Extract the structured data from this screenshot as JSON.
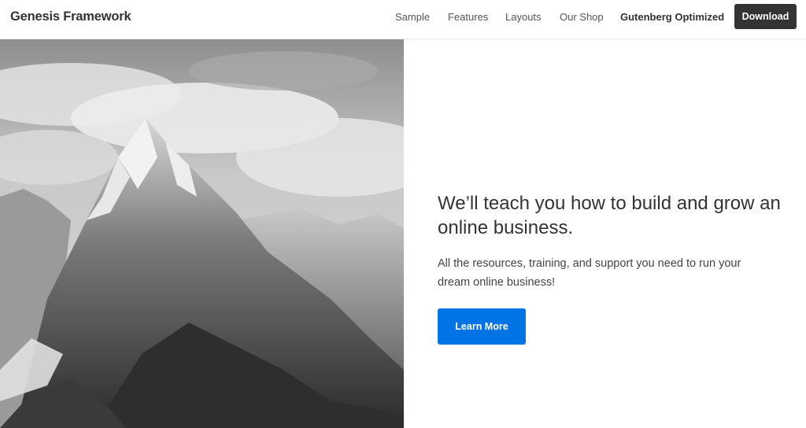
{
  "header": {
    "site_title": "Genesis Framework",
    "nav": [
      {
        "label": "Sample"
      },
      {
        "label": "Features"
      },
      {
        "label": "Layouts"
      },
      {
        "label": "Our Shop"
      },
      {
        "label": "Gutenberg Optimized"
      }
    ],
    "download_label": "Download"
  },
  "hero": {
    "image_alt": "mountain-photo",
    "title": "We’ll teach you how to build and grow an online business.",
    "subtitle": "All the resources, training, and support you need to run your dream online business!",
    "cta_label": "Learn More"
  },
  "colors": {
    "accent": "#0073e5",
    "download_bg": "#333333"
  }
}
